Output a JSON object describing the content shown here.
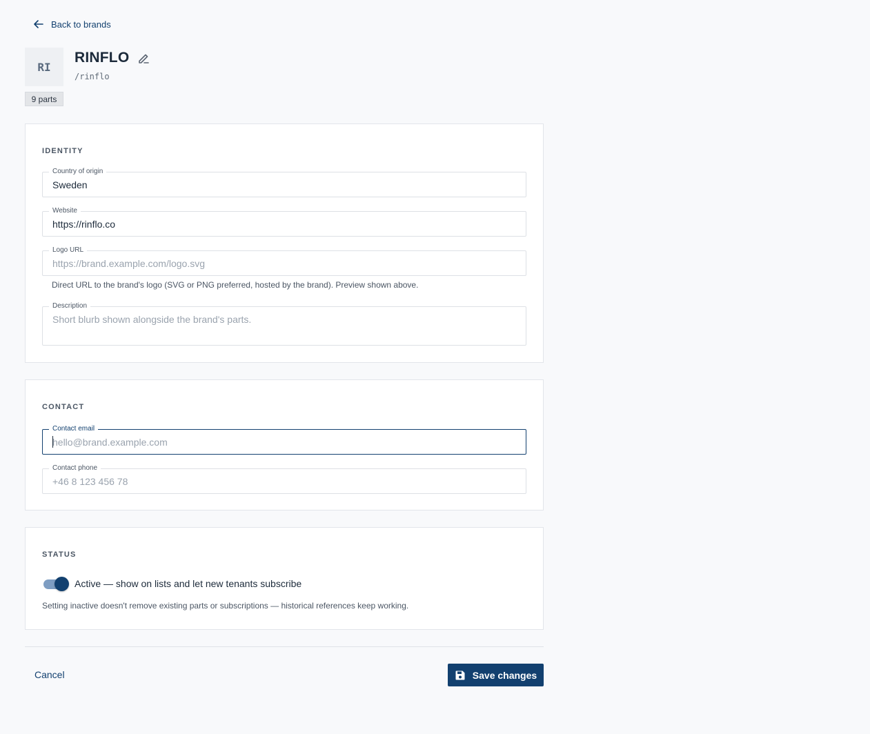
{
  "nav": {
    "back_label": "Back to brands"
  },
  "brand": {
    "initials": "RI",
    "name": "RINFLO",
    "slug": "/rinflo",
    "parts_badge": "9 parts"
  },
  "identity": {
    "title": "IDENTITY",
    "country": {
      "label": "Country of origin",
      "value": "Sweden"
    },
    "website": {
      "label": "Website",
      "value": "https://rinflo.co"
    },
    "logo_url": {
      "label": "Logo URL",
      "placeholder": "https://brand.example.com/logo.svg",
      "helper": "Direct URL to the brand's logo (SVG or PNG preferred, hosted by the brand). Preview shown above."
    },
    "description": {
      "label": "Description",
      "placeholder": "Short blurb shown alongside the brand's parts."
    }
  },
  "contact": {
    "title": "CONTACT",
    "email": {
      "label": "Contact email",
      "placeholder": "hello@brand.example.com"
    },
    "phone": {
      "label": "Contact phone",
      "placeholder": "+46 8 123 456 78"
    }
  },
  "status": {
    "title": "STATUS",
    "active": true,
    "toggle_label": "Active — show on lists and let new tenants subscribe",
    "note": "Setting inactive doesn't remove existing parts or subscriptions — historical references keep working."
  },
  "actions": {
    "cancel_label": "Cancel",
    "save_label": "Save changes"
  },
  "colors": {
    "accent": "#12406f",
    "background": "#f8f9fb",
    "toggle_track": "#7e9dc2"
  }
}
